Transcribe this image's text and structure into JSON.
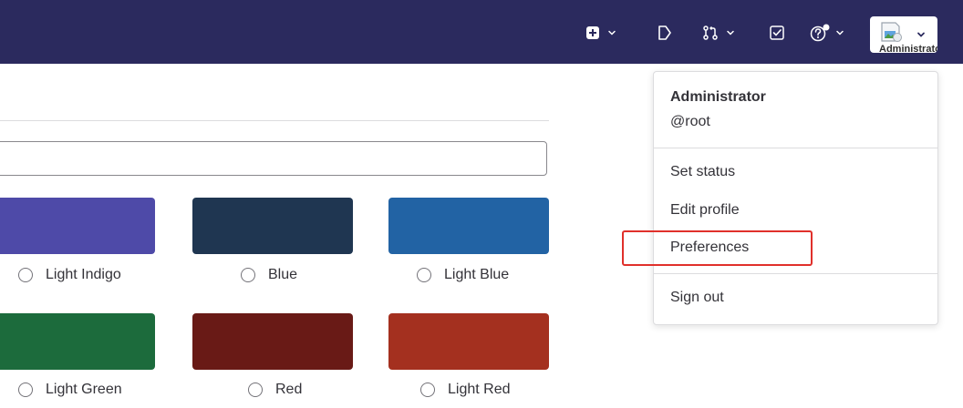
{
  "navbar": {
    "background": "#2b2a5e",
    "icons": [
      "plus-square-icon",
      "chevron-down-icon",
      "issues-icon",
      "merge-request-icon",
      "chevron-down-icon",
      "todo-icon",
      "help-icon",
      "chevron-down-icon"
    ],
    "avatar_alt": "Administrator"
  },
  "themes": [
    {
      "label": "Light Indigo",
      "color": "#4e4aa8"
    },
    {
      "label": "Blue",
      "color": "#1f3651"
    },
    {
      "label": "Light Blue",
      "color": "#2263a4"
    },
    {
      "label": "Light Green",
      "color": "#1c6b3c"
    },
    {
      "label": "Red",
      "color": "#691a16"
    },
    {
      "label": "Light Red",
      "color": "#a4301f"
    }
  ],
  "user_menu": {
    "name": "Administrator",
    "username": "@root",
    "items": [
      "Set status",
      "Edit profile",
      "Preferences",
      "Sign out"
    ]
  },
  "highlight_color": "#e0302b"
}
